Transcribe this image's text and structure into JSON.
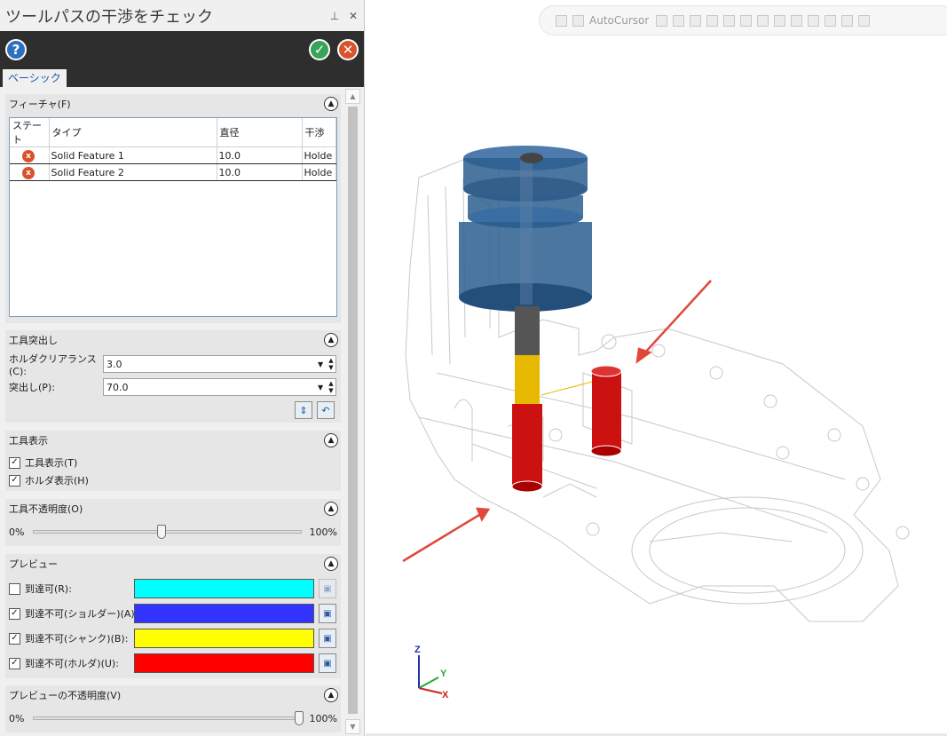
{
  "dialog": {
    "title": "ツールパスの干渉をチェック",
    "tab_basic": "ベーシック",
    "help_icon": "help-icon",
    "ok_icon": "check-icon",
    "cancel_icon": "close-icon"
  },
  "features": {
    "header": "フィーチャ(F)",
    "columns": [
      "ステート",
      "タイプ",
      "直径",
      "干渉"
    ],
    "rows": [
      {
        "state": "error",
        "type": "Solid Feature 1",
        "diameter": "10.0",
        "collision": "Holde"
      },
      {
        "state": "error",
        "type": "Solid Feature 2",
        "diameter": "10.0",
        "collision": "Holde"
      }
    ]
  },
  "tool_stickout": {
    "header": "工具突出し",
    "holder_clearance_label": "ホルダクリアランス(C):",
    "holder_clearance_value": "3.0",
    "stickout_label": "突出し(P):",
    "stickout_value": "70.0"
  },
  "tool_display": {
    "header": "工具表示",
    "show_tool_label": "工具表示(T)",
    "show_tool_checked": true,
    "show_holder_label": "ホルダ表示(H)",
    "show_holder_checked": true
  },
  "tool_opacity": {
    "header": "工具不透明度(O)",
    "min_label": "0%",
    "max_label": "100%",
    "value_fraction": 0.48
  },
  "preview": {
    "header": "プレビュー",
    "items": [
      {
        "label": "到達可(R):",
        "checked": false,
        "color": "#00ffff"
      },
      {
        "label": "到達不可(ショルダー)(A):",
        "checked": true,
        "color": "#3333ff"
      },
      {
        "label": "到達不可(シャンク)(B):",
        "checked": true,
        "color": "#ffff00"
      },
      {
        "label": "到達不可(ホルダ)(U):",
        "checked": true,
        "color": "#ff0000"
      }
    ]
  },
  "preview_opacity": {
    "header": "プレビューの不透明度(V)",
    "min_label": "0%",
    "max_label": "100%",
    "value_fraction": 0.99
  },
  "viewport": {
    "toolbar_autocursor": "AutoCursor",
    "axis_x": "X",
    "axis_y": "Y",
    "axis_z": "Z",
    "colors": {
      "holder": "#2c5e8e",
      "shank_yellow": "#e6b800",
      "collision_red": "#cc1111",
      "arrow": "#e0483a"
    }
  }
}
